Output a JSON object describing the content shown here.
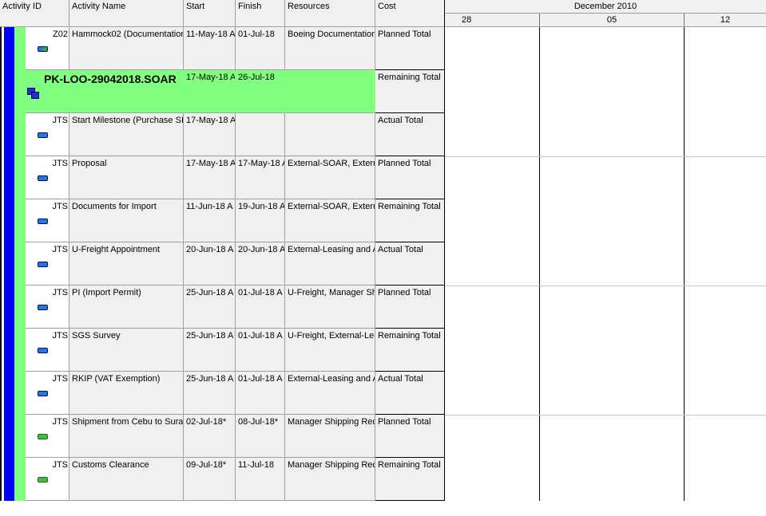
{
  "columns": {
    "activity_id": "Activity ID",
    "activity_name": "Activity Name",
    "start": "Start",
    "finish": "Finish",
    "resources": "Resources",
    "cost": "Cost"
  },
  "gantt": {
    "month": "December 2010",
    "weeks": [
      "28",
      "05",
      "12"
    ]
  },
  "rows": [
    {
      "id": "Z02",
      "name": "Hammock02 (Documentation",
      "start": "11-May-18 A",
      "finish": "01-Jul-18",
      "resources": "Boeing Documentation",
      "cost": "Planned Total",
      "icon": "mixed"
    },
    {
      "id": "",
      "name": "PK-LOO-29042018.SOAR",
      "start": "17-May-18 A",
      "finish": "26-Jul-18",
      "resources": "",
      "cost": "Remaining Total",
      "icon": "wbs"
    },
    {
      "id": "JTS",
      "name": "Start Milestone (Purchase SI",
      "start": "17-May-18 A",
      "finish": "",
      "resources": "",
      "cost": "Actual Total",
      "icon": "blue"
    },
    {
      "id": "JTS",
      "name": "Proposal",
      "start": "17-May-18 A",
      "finish": "17-May-18 A",
      "resources": "External-SOAR, External",
      "cost": "Planned Total",
      "icon": "blue"
    },
    {
      "id": "JTS",
      "name": "Documents for Import",
      "start": "11-Jun-18 A",
      "finish": "19-Jun-18 A",
      "resources": "External-SOAR, External",
      "cost": "Remaining Total",
      "icon": "blue"
    },
    {
      "id": "JTS",
      "name": "U-Freight Appointment",
      "start": "20-Jun-18 A",
      "finish": "20-Jun-18 A",
      "resources": "External-Leasing and A",
      "cost": "Actual Total",
      "icon": "blue"
    },
    {
      "id": "JTS",
      "name": "PI (Import Permit)",
      "start": "25-Jun-18 A",
      "finish": "01-Jul-18 A",
      "resources": "U-Freight, Manager Sh",
      "cost": "Planned Total",
      "icon": "blue"
    },
    {
      "id": "JTS",
      "name": "SGS Survey",
      "start": "25-Jun-18 A",
      "finish": "01-Jul-18 A",
      "resources": "U-Freight, External-Le",
      "cost": "Remaining Total",
      "icon": "blue"
    },
    {
      "id": "JTS",
      "name": "RKIP (VAT Exemption)",
      "start": "25-Jun-18 A",
      "finish": "01-Jul-18 A",
      "resources": "External-Leasing and A",
      "cost": "Actual Total",
      "icon": "blue"
    },
    {
      "id": "JTS",
      "name": "Shipment from Cebu to Sura",
      "start": "02-Jul-18*",
      "finish": "08-Jul-18*",
      "resources": "Manager Shipping Rec",
      "cost": "Planned Total",
      "icon": "green"
    },
    {
      "id": "JTS",
      "name": "Customs Clearance",
      "start": "09-Jul-18*",
      "finish": "11-Jul-18",
      "resources": "Manager Shipping Rec",
      "cost": "Remaining Total",
      "icon": "green"
    }
  ]
}
